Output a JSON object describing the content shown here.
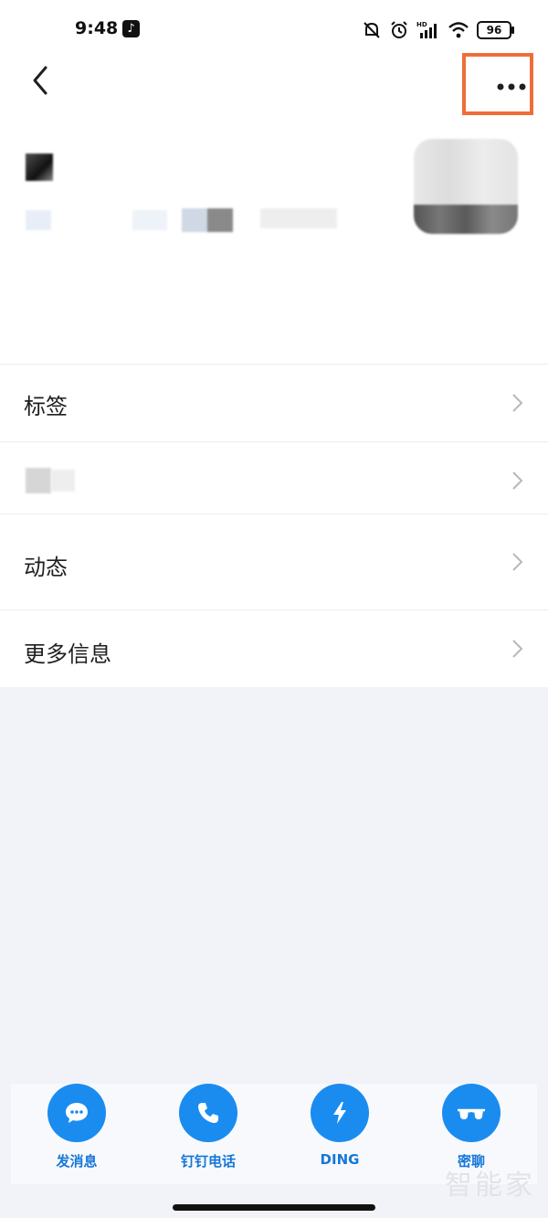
{
  "status_bar": {
    "time": "9:48",
    "app_icon": "tiktok-icon",
    "signal_label": "HD",
    "battery": "96"
  },
  "header": {
    "back_icon": "chevron-left-icon",
    "more_icon": "more-horizontal-icon",
    "highlight_color": "#f06d3a"
  },
  "list": {
    "items": [
      {
        "label": "标签"
      },
      {
        "label": ""
      },
      {
        "label": "动态"
      },
      {
        "label": "更多信息"
      }
    ]
  },
  "actions": [
    {
      "label": "发消息",
      "icon": "message-icon"
    },
    {
      "label": "钉钉电话",
      "icon": "phone-icon"
    },
    {
      "label": "DING",
      "icon": "lightning-icon"
    },
    {
      "label": "密聊",
      "icon": "glasses-icon"
    }
  ],
  "accent_color": "#1a8cf0",
  "watermark": "智能家"
}
